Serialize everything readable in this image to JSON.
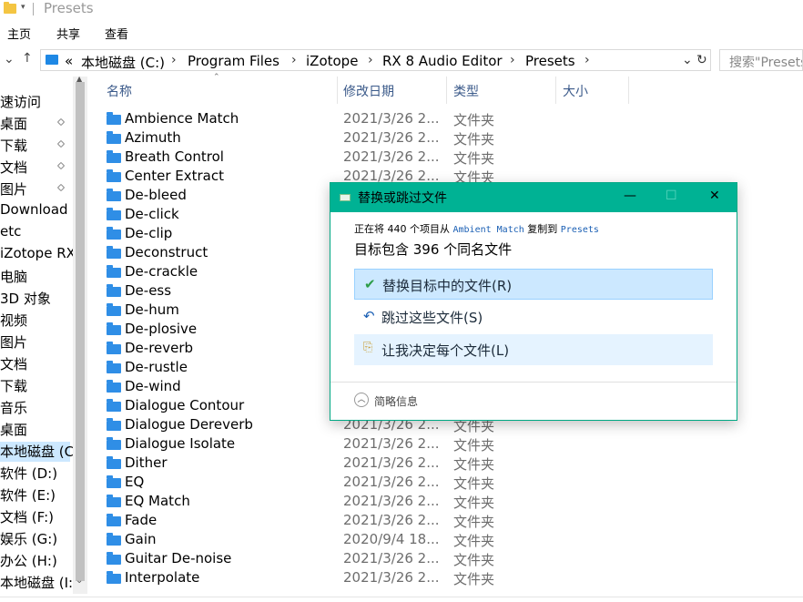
{
  "window": {
    "title": "Presets"
  },
  "ribbon": {
    "tabs": [
      "主页",
      "共享",
      "查看"
    ]
  },
  "address": {
    "crumbs": [
      "本地磁盘 (C:)",
      "Program Files",
      "iZotope",
      "RX 8 Audio Editor",
      "Presets"
    ],
    "overflow": "«",
    "search_placeholder": "搜索\"Presets\""
  },
  "nav": {
    "items": [
      {
        "label": "速访问",
        "pinned": false
      },
      {
        "label": "桌面",
        "pinned": true
      },
      {
        "label": "下载",
        "pinned": true
      },
      {
        "label": "文档",
        "pinned": true
      },
      {
        "label": "图片",
        "pinned": true
      },
      {
        "label": "Download",
        "pinned": false
      },
      {
        "label": "etc",
        "pinned": false
      },
      {
        "label": "iZotope RX",
        "pinned": false
      },
      {
        "label": "电脑",
        "pinned": false
      },
      {
        "label": "3D 对象",
        "pinned": false
      },
      {
        "label": "视频",
        "pinned": false
      },
      {
        "label": "图片",
        "pinned": false
      },
      {
        "label": "文档",
        "pinned": false
      },
      {
        "label": "下载",
        "pinned": false
      },
      {
        "label": "音乐",
        "pinned": false
      },
      {
        "label": "桌面",
        "pinned": false
      },
      {
        "label": "本地磁盘 (C:",
        "pinned": false,
        "selected": true
      },
      {
        "label": "软件 (D:)",
        "pinned": false
      },
      {
        "label": "软件 (E:)",
        "pinned": false
      },
      {
        "label": "文档 (F:)",
        "pinned": false
      },
      {
        "label": "娱乐 (G:)",
        "pinned": false
      },
      {
        "label": "办公 (H:)",
        "pinned": false
      },
      {
        "label": "本地磁盘 (I:)",
        "pinned": false
      }
    ]
  },
  "columns": {
    "name": "名称",
    "date": "修改日期",
    "type": "类型",
    "size": "大小"
  },
  "files": [
    {
      "name": "Ambience Match",
      "date": "2021/3/26 2...",
      "type": "文件夹"
    },
    {
      "name": "Azimuth",
      "date": "2021/3/26 2...",
      "type": "文件夹"
    },
    {
      "name": "Breath Control",
      "date": "2021/3/26 2...",
      "type": "文件夹"
    },
    {
      "name": "Center Extract",
      "date": "2021/3/26 2...",
      "type": "文件夹"
    },
    {
      "name": "De-bleed",
      "date": "",
      "type": ""
    },
    {
      "name": "De-click",
      "date": "",
      "type": ""
    },
    {
      "name": "De-clip",
      "date": "",
      "type": ""
    },
    {
      "name": "Deconstruct",
      "date": "",
      "type": ""
    },
    {
      "name": "De-crackle",
      "date": "",
      "type": ""
    },
    {
      "name": "De-ess",
      "date": "",
      "type": ""
    },
    {
      "name": "De-hum",
      "date": "",
      "type": ""
    },
    {
      "name": "De-plosive",
      "date": "",
      "type": ""
    },
    {
      "name": "De-reverb",
      "date": "",
      "type": ""
    },
    {
      "name": "De-rustle",
      "date": "",
      "type": ""
    },
    {
      "name": "De-wind",
      "date": "",
      "type": ""
    },
    {
      "name": "Dialogue Contour",
      "date": "",
      "type": ""
    },
    {
      "name": "Dialogue Dereverb",
      "date": "2021/3/26 2...",
      "type": "文件夹"
    },
    {
      "name": "Dialogue Isolate",
      "date": "2021/3/26 2...",
      "type": "文件夹"
    },
    {
      "name": "Dither",
      "date": "2021/3/26 2...",
      "type": "文件夹"
    },
    {
      "name": "EQ",
      "date": "2021/3/26 2...",
      "type": "文件夹"
    },
    {
      "name": "EQ Match",
      "date": "2021/3/26 2...",
      "type": "文件夹"
    },
    {
      "name": "Fade",
      "date": "2021/3/26 2...",
      "type": "文件夹"
    },
    {
      "name": "Gain",
      "date": "2020/9/4 18...",
      "type": "文件夹"
    },
    {
      "name": "Guitar De-noise",
      "date": "2021/3/26 2...",
      "type": "文件夹"
    },
    {
      "name": "Interpolate",
      "date": "2021/3/26 2...",
      "type": "文件夹"
    }
  ],
  "dialog": {
    "title": "替换或跳过文件",
    "msg_prefix": "正在将 440 个项目从 ",
    "msg_source": "Ambient Match",
    "msg_middle": " 复制到 ",
    "msg_dest": "Presets",
    "msg2": "目标包含 396 个同名文件",
    "options": {
      "replace": "替换目标中的文件(R)",
      "skip": "跳过这些文件(S)",
      "decide": "让我决定每个文件(L)"
    },
    "more": "简略信息",
    "controls": {
      "minimize": "—",
      "maximize": "☐",
      "close": "✕"
    }
  },
  "colors": {
    "accent": "#00b294",
    "folder": "#2f8ee6",
    "selection": "#cce8ff"
  }
}
